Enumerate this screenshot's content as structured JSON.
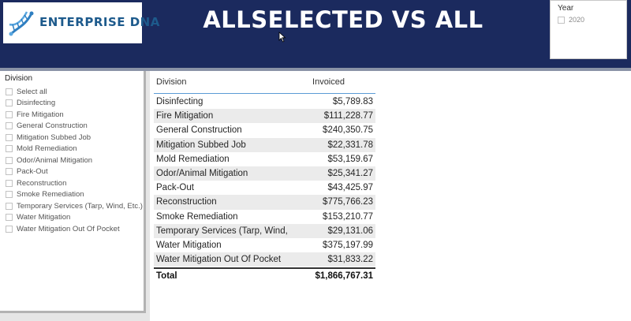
{
  "header": {
    "logo_text": "ENTERPRISE DNA",
    "title": "ALLSELECTED VS ALL",
    "bg_color": "#1b2a5e"
  },
  "year_slicer": {
    "title": "Year",
    "items": [
      {
        "label": "2020",
        "checked": false
      }
    ]
  },
  "division_slicer": {
    "title": "Division",
    "items": [
      {
        "label": "Select all",
        "checked": false
      },
      {
        "label": "Disinfecting",
        "checked": false
      },
      {
        "label": "Fire Mitigation",
        "checked": false
      },
      {
        "label": "General Construction",
        "checked": false
      },
      {
        "label": "Mitigation Subbed Job",
        "checked": false
      },
      {
        "label": "Mold Remediation",
        "checked": false
      },
      {
        "label": "Odor/Animal Mitigation",
        "checked": false
      },
      {
        "label": "Pack-Out",
        "checked": false
      },
      {
        "label": "Reconstruction",
        "checked": false
      },
      {
        "label": "Smoke Remediation",
        "checked": false
      },
      {
        "label": "Temporary Services (Tarp, Wind, Etc.)",
        "checked": false
      },
      {
        "label": "Water Mitigation",
        "checked": false
      },
      {
        "label": "Water Mitigation Out Of Pocket",
        "checked": false
      }
    ]
  },
  "table": {
    "columns": [
      "Division",
      "Invoiced"
    ],
    "rows": [
      [
        "Disinfecting",
        "$5,789.83"
      ],
      [
        "Fire Mitigation",
        "$111,228.77"
      ],
      [
        "General Construction",
        "$240,350.75"
      ],
      [
        "Mitigation Subbed Job",
        "$22,331.78"
      ],
      [
        "Mold Remediation",
        "$53,159.67"
      ],
      [
        "Odor/Animal Mitigation",
        "$25,341.27"
      ],
      [
        "Pack-Out",
        "$43,425.97"
      ],
      [
        "Reconstruction",
        "$775,766.23"
      ],
      [
        "Smoke Remediation",
        "$153,210.77"
      ],
      [
        "Temporary Services (Tarp, Wind, Etc.)",
        "$29,131.06"
      ],
      [
        "Water Mitigation",
        "$375,197.99"
      ],
      [
        "Water Mitigation Out Of Pocket",
        "$31,833.22"
      ]
    ],
    "total_label": "Total",
    "total_value": "$1,866,767.31"
  },
  "icons": {
    "logo": "dna-helix-icon",
    "cursor": "mouse-pointer-icon"
  },
  "colors": {
    "header_bg": "#1b2a5e",
    "logo_text": "#1d5a8c",
    "table_header_rule": "#5b9bd5",
    "row_alt": "#ebebeb"
  }
}
